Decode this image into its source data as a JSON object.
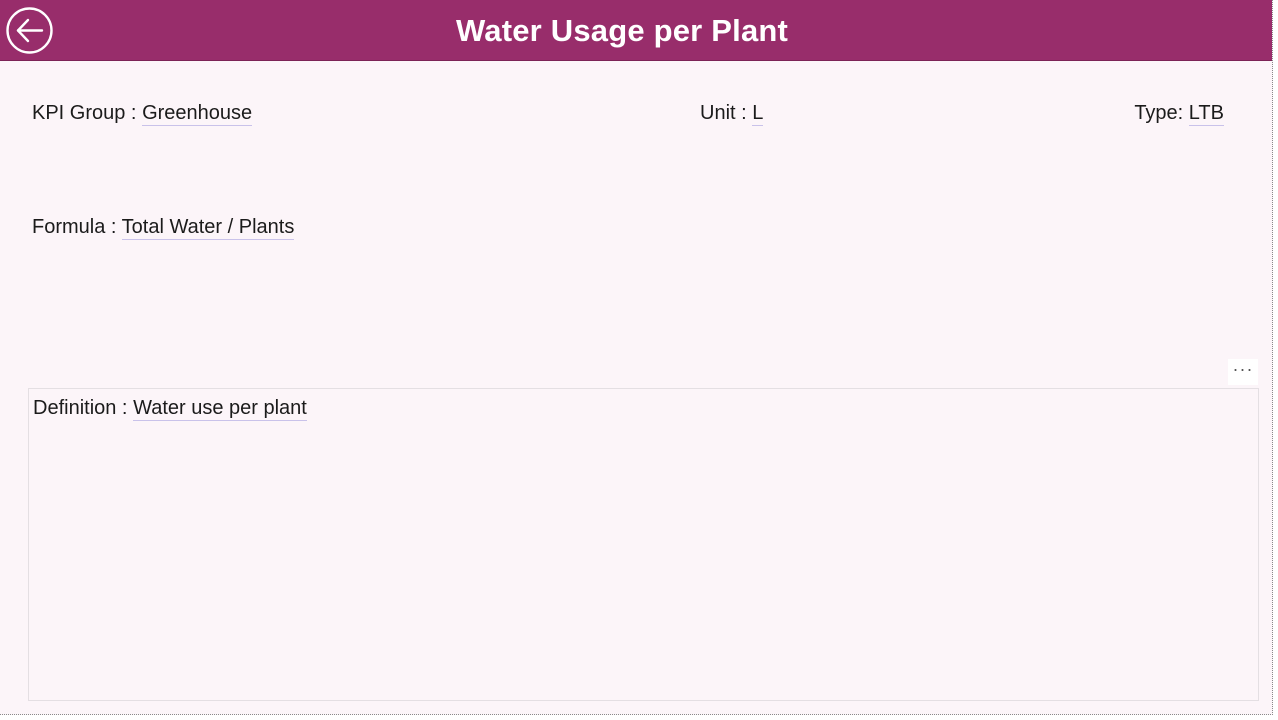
{
  "header": {
    "title": "Water Usage per Plant",
    "back_icon": "arrow-left-circle-icon",
    "bg_color": "#982d6b"
  },
  "fields": {
    "kpi_group_label": "KPI Group : ",
    "kpi_group_value": "Greenhouse",
    "unit_label": "Unit : ",
    "unit_value": "L",
    "type_label": "Type: ",
    "type_value": "LTB",
    "formula_label": "Formula : ",
    "formula_value": "Total Water / Plants"
  },
  "more_options": {
    "label": "···",
    "icon": "more-options-icon"
  },
  "definition": {
    "label": "Definition : ",
    "value": "Water use per plant"
  }
}
